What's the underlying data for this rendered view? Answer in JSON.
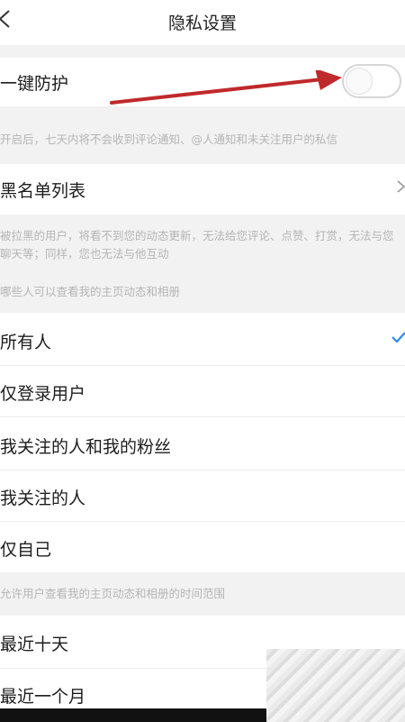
{
  "header": {
    "title": "隐私设置"
  },
  "protection": {
    "label": "一键防护",
    "toggle_on": false,
    "note": "开启后，七天内将不会收到评论通知、@人通知和未关注用户的私信"
  },
  "blacklist": {
    "label": "黑名单列表",
    "note": "被拉黑的用户，将看不到您的动态更新，无法给您评论、点赞、打赏，无法与您聊天等；同样，您也无法与他互动"
  },
  "visibility": {
    "section_title": "哪些人可以查看我的主页动态和相册",
    "options": [
      {
        "label": "所有人",
        "selected": true
      },
      {
        "label": "仅登录用户",
        "selected": false
      },
      {
        "label": "我关注的人和我的粉丝",
        "selected": false
      },
      {
        "label": "我关注的人",
        "selected": false
      },
      {
        "label": "仅自己",
        "selected": false
      }
    ]
  },
  "range": {
    "section_title": "允许用户查看我的主页动态和相册的时间范围",
    "options": [
      {
        "label": "最近十天"
      },
      {
        "label": "最近一个月"
      }
    ]
  },
  "colors": {
    "accent": "#2d8cf0",
    "annotation_arrow": "#c0292b",
    "note_text": "#b5b5b5"
  }
}
